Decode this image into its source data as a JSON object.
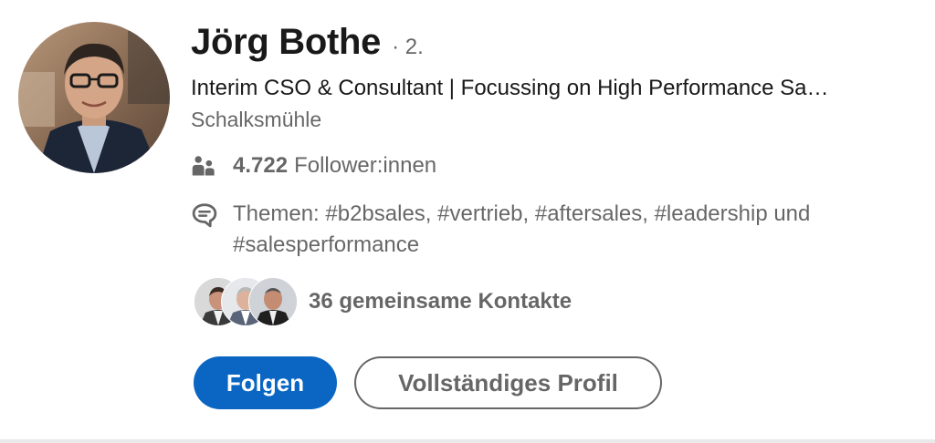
{
  "profile": {
    "name": "Jörg Bothe",
    "degree": "· 2.",
    "headline": "Interim CSO & Consultant | Focussing on High Performance Sa…",
    "location": "Schalksmühle",
    "followers_count": "4.722",
    "followers_label": "Follower:innen",
    "topics": "Themen: #b2bsales, #vertrieb, #aftersales, #leadership und #salesperformance",
    "mutual_connections": "36 gemeinsame Kontakte"
  },
  "buttons": {
    "follow_label": "Folgen",
    "full_profile_label": "Vollständiges Profil"
  },
  "icons": {
    "followers": "people-icon",
    "topics": "speech-bubble-icon"
  },
  "colors": {
    "primary": "#0a66c2",
    "primary_text": "#ffffff",
    "secondary_text": "#666666",
    "divider": "#e9e9e9"
  }
}
